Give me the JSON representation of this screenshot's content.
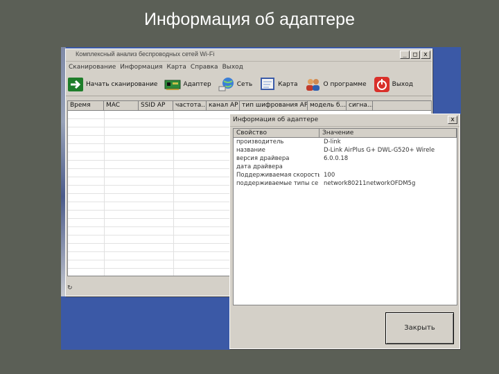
{
  "slide": {
    "title": "Информация об адаптере"
  },
  "main_window": {
    "title": "Комплексный анализ беспроводных сетей Wi-Fi",
    "controls": [
      "_",
      "□",
      "x"
    ],
    "menu": [
      "Сканирование",
      "Информация",
      "Карта",
      "Справка",
      "Выход"
    ],
    "toolbar": [
      {
        "label": "Начать сканирование",
        "icon": "arrow-right-icon"
      },
      {
        "label": "Адаптер",
        "icon": "network-card-icon"
      },
      {
        "label": "Сеть",
        "icon": "globe-network-icon"
      },
      {
        "label": "Карта",
        "icon": "map-icon"
      },
      {
        "label": "О программе",
        "icon": "users-icon"
      },
      {
        "label": "Выход",
        "icon": "power-icon"
      }
    ],
    "grid_columns": [
      "Время",
      "MAC",
      "SSID AP",
      "частота...",
      "канал AP",
      "тип шифрования AP",
      "модель б...",
      "сигна..."
    ]
  },
  "dialog": {
    "title": "Информация об адаптере",
    "close": "x",
    "columns": [
      "Свойство",
      "Значение"
    ],
    "rows": [
      {
        "key": "производитель",
        "value": "D-link"
      },
      {
        "key": "название",
        "value": "D-Link AirPlus G+ DWL-G520+ Wirele"
      },
      {
        "key": "версия драйвера",
        "value": "6.0.0.18"
      },
      {
        "key": "дата драйвера",
        "value": ""
      },
      {
        "key": "Поддерживаемая скорость",
        "value": "100"
      },
      {
        "key": "поддерживаемые типы се",
        "value": "network80211networkOFDM5g"
      }
    ],
    "close_button": "Закрыть"
  }
}
